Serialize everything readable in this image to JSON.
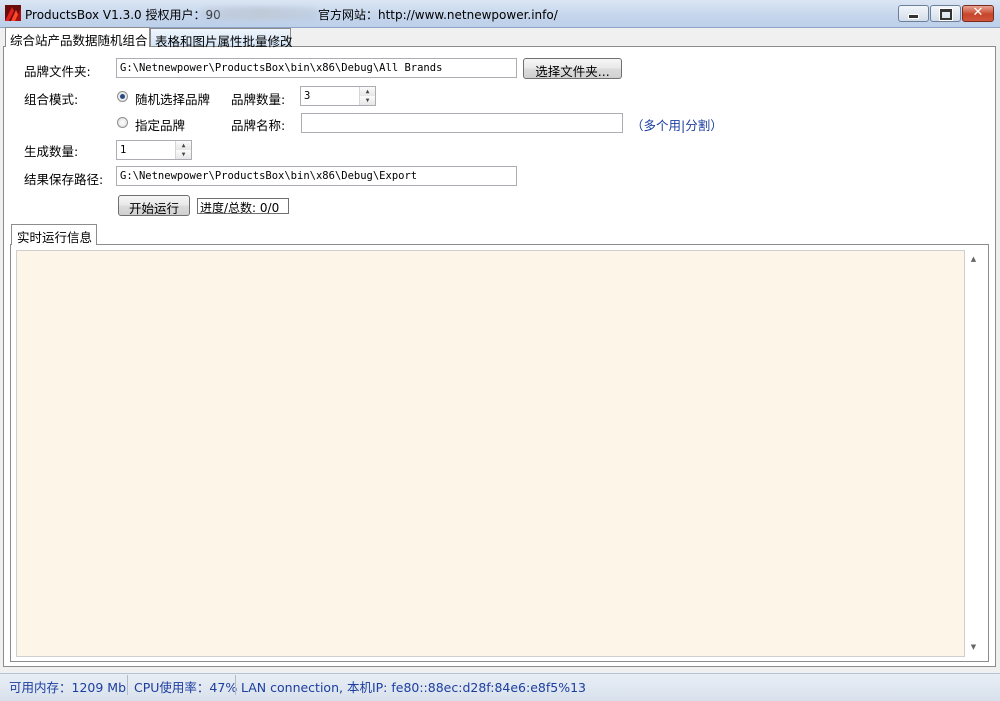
{
  "window": {
    "title": "ProductsBox V1.3.0 授权用户：90",
    "website": "官方网站：http://www.netnewpower.info/",
    "close_glyph": "✕"
  },
  "tabs": [
    {
      "label": "综合站产品数据随机组合",
      "active": true
    },
    {
      "label": "表格和图片属性批量修改",
      "active": false
    }
  ],
  "form": {
    "brand_folder_label": "品牌文件夹:",
    "brand_folder_value": "G:\\Netnewpower\\ProductsBox\\bin\\x86\\Debug\\All Brands",
    "choose_folder_button": "选择文件夹...",
    "mode_label": "组合模式:",
    "random_brand_option": "随机选择品牌",
    "specific_brand_option": "指定品牌",
    "selected_mode": "random",
    "brand_count_label": "品牌数量:",
    "brand_count_value": "3",
    "brand_name_label": "品牌名称:",
    "brand_name_value": "",
    "brand_name_hint": "（多个用|分割）",
    "generate_count_label": "生成数量:",
    "generate_count_value": "1",
    "save_path_label": "结果保存路径:",
    "save_path_value": "G:\\Netnewpower\\ProductsBox\\bin\\x86\\Debug\\Export",
    "start_button": "开始运行",
    "progress_text": "进度/总数: 0/0"
  },
  "log": {
    "tab_label": "实时运行信息",
    "content": ""
  },
  "statusbar": {
    "memory": "可用内存：1209 Mb",
    "cpu": "CPU使用率：47%",
    "network": "LAN connection,  本机IP: fe80::88ec:d28f:84e6:e8f5%13"
  },
  "icons": {
    "app": "productsbox-app-icon",
    "minimize": "minimize-icon",
    "maximize": "maximize-icon",
    "close": "close-icon",
    "spin_up": "spin-up-icon",
    "spin_down": "spin-down-icon",
    "scroll_up": "scroll-up-icon",
    "scroll_down": "scroll-down-icon"
  },
  "colors": {
    "hint_text": "#1c3ea0",
    "log_background": "#fcf5e8",
    "status_text": "#1c3ea0"
  }
}
